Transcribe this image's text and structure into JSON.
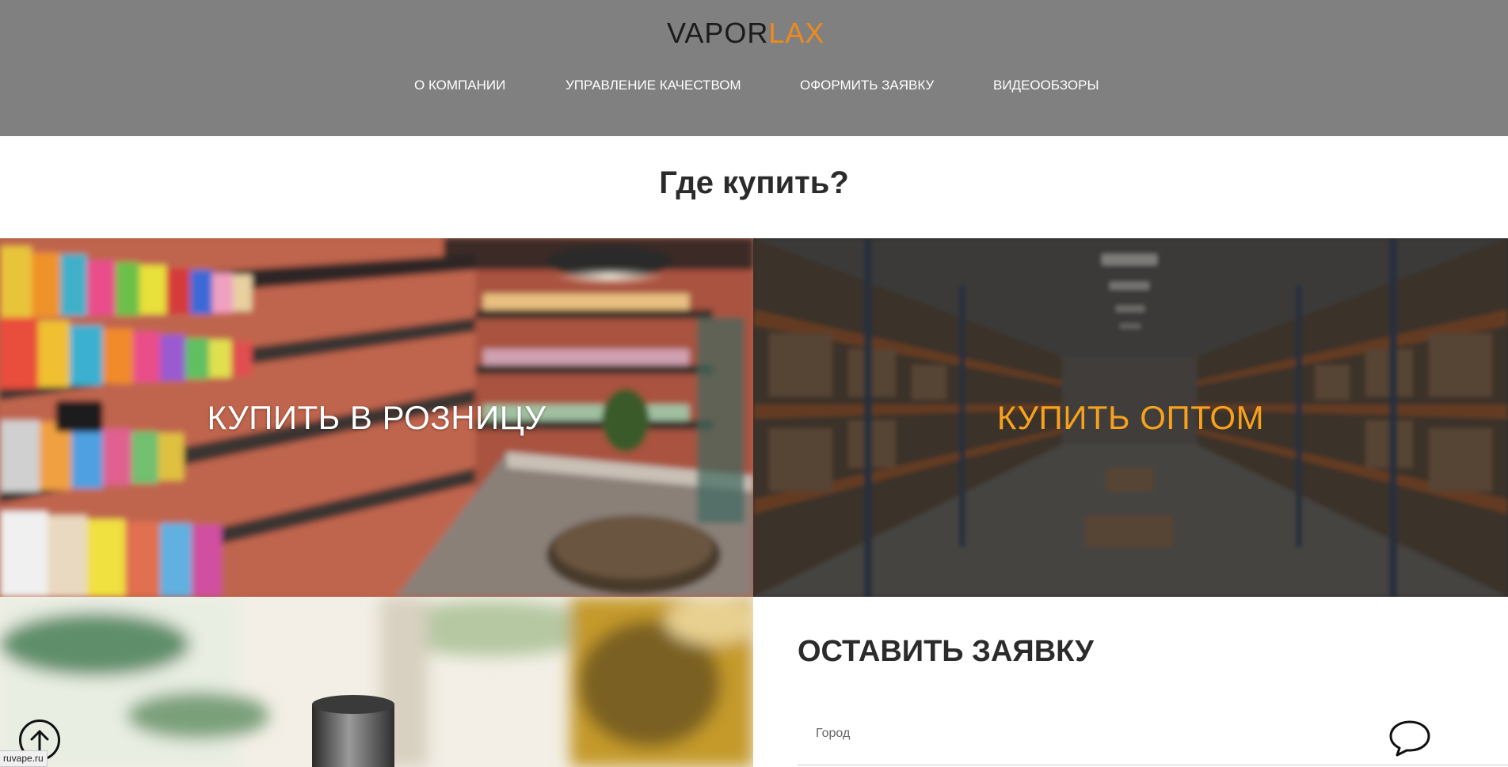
{
  "header": {
    "logo_left": "VAPOR",
    "logo_right": "LAX",
    "nav": [
      {
        "label": "О КОМПАНИИ"
      },
      {
        "label": "УПРАВЛЕНИЕ КАЧЕСТВОМ"
      },
      {
        "label": "ОФОРМИТЬ ЗАЯВКУ"
      },
      {
        "label": "ВИДЕООБЗОРЫ"
      }
    ]
  },
  "main": {
    "title": "Где купить?",
    "tiles": {
      "retail_label": "КУПИТЬ В РОЗНИЦУ",
      "wholesale_label": "КУПИТЬ ОПТОМ"
    }
  },
  "form": {
    "title": "ОСТАВИТЬ ЗАЯВКУ",
    "city_placeholder": "Город"
  },
  "status_bar": {
    "url": "ruvape.ru"
  },
  "colors": {
    "header_bg": "#808080",
    "accent_orange": "#f7a11e",
    "logo_orange": "#f08a1c"
  },
  "icons": {
    "scroll_top": "arrow-up-circle-icon",
    "chat": "chat-bubble-icon"
  }
}
